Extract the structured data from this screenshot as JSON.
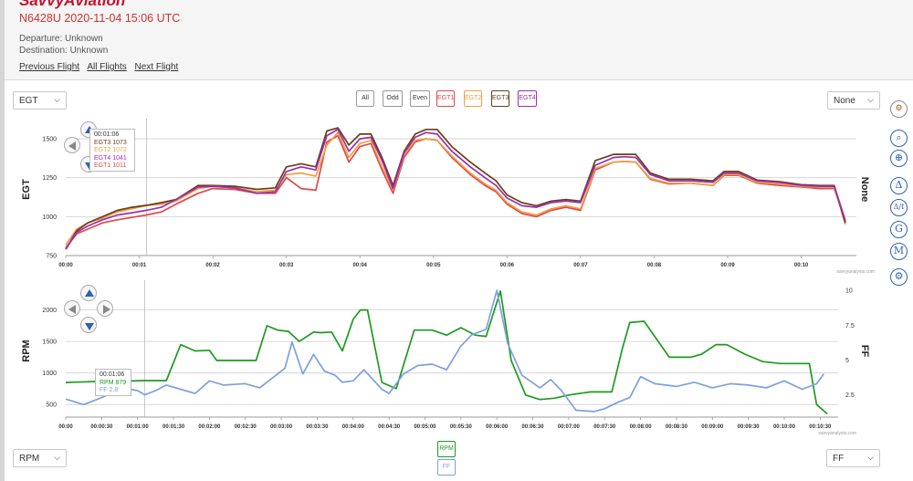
{
  "header": {
    "logo": "SavvyAviation",
    "flight_title": "N6428U 2020-11-04 15:06 UTC",
    "departure": "Departure: Unknown",
    "destination": "Destination: Unknown",
    "prev_flight": "Previous Flight",
    "all_flights": "All Flights",
    "next_flight": "Next Flight"
  },
  "controls": {
    "top_left_select": "EGT",
    "top_right_select": "None",
    "bottom_left_select": "RPM",
    "bottom_right_select": "FF",
    "filters": [
      "All",
      "Odd",
      "Even",
      "EGT1",
      "EGT2",
      "EGT3",
      "EGT4"
    ],
    "bottom_buttons": [
      "RPM",
      "FF"
    ]
  },
  "right_toolbar": {
    "icons": [
      "gear-settings-icon",
      "zoom-reset-icon",
      "zoom-in-icon",
      "delta-icon",
      "delta-t-icon",
      "g-icon",
      "m-icon",
      "settings-icon"
    ],
    "glyphs": [
      "",
      "",
      "",
      "Δ",
      "Δ/t",
      "G",
      "M",
      ""
    ]
  },
  "colors": {
    "egt1": "#e04848",
    "egt2": "#f0a040",
    "egt3": "#6b3f1c",
    "egt4": "#9a2fb0",
    "rpm": "#1e9a1e",
    "ff": "#7ea0e0",
    "accent_blue": "#2f62b0",
    "title_red": "#d03030"
  },
  "tooltip_top": {
    "time": "00:01:06",
    "rows": [
      {
        "label": "EGT3",
        "value": "1073",
        "key": "egt3"
      },
      {
        "label": "EGT2",
        "value": "1072",
        "key": "egt2"
      },
      {
        "label": "EGT4",
        "value": "1041",
        "key": "egt4"
      },
      {
        "label": "EGT1",
        "value": "1011",
        "key": "egt1"
      }
    ]
  },
  "tooltip_bottom": {
    "time": "00:01:06",
    "rows": [
      {
        "label": "RPM",
        "value": "879",
        "key": "rpm"
      },
      {
        "label": "FF",
        "value": "2.8",
        "key": "ff"
      }
    ]
  },
  "watermark": "savvyanalysis.com",
  "chart_data": [
    {
      "type": "line",
      "ylabel": "EGT",
      "right_label": "None",
      "ylim": [
        750,
        1600
      ],
      "yticks": [
        750,
        1000,
        1250,
        1500
      ],
      "xlim": [
        0,
        10.75
      ],
      "xticks": [
        0,
        1,
        2,
        3,
        4,
        5,
        6,
        7,
        8,
        9,
        10
      ],
      "xtick_labels": [
        "00:00",
        "00:01",
        "00:02",
        "00:03",
        "00:04",
        "00:05",
        "00:06",
        "00:07",
        "00:08",
        "00:09",
        "00:10"
      ],
      "grid": true,
      "x": [
        0,
        0.15,
        0.3,
        0.5,
        0.7,
        0.9,
        1.1,
        1.3,
        1.5,
        1.8,
        2.0,
        2.3,
        2.6,
        2.85,
        3.0,
        3.2,
        3.4,
        3.55,
        3.7,
        3.85,
        4.0,
        4.15,
        4.3,
        4.45,
        4.6,
        4.75,
        4.9,
        5.05,
        5.25,
        5.5,
        5.7,
        5.85,
        6.0,
        6.2,
        6.4,
        6.6,
        6.8,
        7.0,
        7.2,
        7.45,
        7.6,
        7.75,
        7.95,
        8.2,
        8.5,
        8.8,
        8.95,
        9.15,
        9.4,
        9.7,
        10.0,
        10.25,
        10.45,
        10.6
      ],
      "series": [
        {
          "name": "EGT1",
          "key": "egt1",
          "values": [
            800,
            890,
            920,
            960,
            980,
            995,
            1011,
            1030,
            1080,
            1150,
            1180,
            1175,
            1150,
            1150,
            1250,
            1180,
            1170,
            1480,
            1520,
            1350,
            1450,
            1470,
            1300,
            1150,
            1380,
            1480,
            1500,
            1490,
            1380,
            1270,
            1200,
            1160,
            1080,
            1020,
            1000,
            1040,
            1060,
            1040,
            1300,
            1350,
            1355,
            1350,
            1240,
            1210,
            1215,
            1200,
            1265,
            1265,
            1215,
            1200,
            1190,
            1180,
            1180,
            970
          ]
        },
        {
          "name": "EGT2",
          "key": "egt2",
          "values": [
            820,
            920,
            960,
            990,
            1030,
            1050,
            1072,
            1080,
            1100,
            1180,
            1195,
            1185,
            1160,
            1170,
            1270,
            1280,
            1260,
            1460,
            1540,
            1380,
            1470,
            1490,
            1320,
            1170,
            1400,
            1490,
            1500,
            1490,
            1390,
            1280,
            1210,
            1170,
            1090,
            1030,
            1010,
            1050,
            1070,
            1050,
            1310,
            1350,
            1355,
            1350,
            1245,
            1215,
            1215,
            1200,
            1270,
            1270,
            1220,
            1210,
            1195,
            1190,
            1190,
            950
          ]
        },
        {
          "name": "EGT3",
          "key": "egt3",
          "values": [
            790,
            910,
            960,
            1000,
            1040,
            1060,
            1073,
            1090,
            1110,
            1200,
            1200,
            1195,
            1175,
            1185,
            1320,
            1340,
            1320,
            1550,
            1570,
            1460,
            1530,
            1530,
            1380,
            1200,
            1420,
            1530,
            1560,
            1560,
            1450,
            1350,
            1280,
            1230,
            1140,
            1090,
            1070,
            1100,
            1110,
            1100,
            1360,
            1400,
            1400,
            1400,
            1280,
            1240,
            1240,
            1230,
            1290,
            1290,
            1235,
            1225,
            1205,
            1200,
            1200,
            960
          ]
        },
        {
          "name": "EGT4",
          "key": "egt4",
          "values": [
            790,
            900,
            940,
            980,
            1010,
            1025,
            1041,
            1060,
            1110,
            1190,
            1195,
            1185,
            1150,
            1160,
            1290,
            1320,
            1300,
            1520,
            1560,
            1420,
            1500,
            1510,
            1360,
            1180,
            1410,
            1510,
            1540,
            1530,
            1420,
            1320,
            1250,
            1200,
            1120,
            1070,
            1060,
            1090,
            1100,
            1090,
            1330,
            1380,
            1385,
            1380,
            1270,
            1230,
            1230,
            1220,
            1280,
            1280,
            1230,
            1220,
            1200,
            1195,
            1195,
            975
          ]
        }
      ]
    },
    {
      "type": "line",
      "ylabel": "RPM",
      "right_label": "FF",
      "ylim": [
        300,
        2400
      ],
      "yticks": [
        500,
        1000,
        1500,
        2000
      ],
      "y2lim": [
        0.9,
        10.4
      ],
      "y2ticks": [
        2.5,
        5,
        7.5,
        10
      ],
      "xlim": [
        0,
        10.75
      ],
      "xticks": [
        0,
        0.5,
        1,
        1.5,
        2,
        2.5,
        3,
        3.5,
        4,
        4.5,
        5,
        5.5,
        6,
        6.5,
        7,
        7.5,
        8,
        8.5,
        9,
        9.5,
        10,
        10.5
      ],
      "xtick_labels": [
        "00:00",
        "00:00:30",
        "00:01:00",
        "00:01:30",
        "00:02:00",
        "00:02:30",
        "00:03:00",
        "00:03:30",
        "00:04:00",
        "00:04:30",
        "00:05:00",
        "00:05:30",
        "00:06:00",
        "00:06:30",
        "00:07:00",
        "00:07:30",
        "00:08:00",
        "00:08:30",
        "00:09:00",
        "00:09:30",
        "00:10:00",
        "00:10:30"
      ],
      "grid": true,
      "series": [
        {
          "name": "RPM",
          "key": "rpm",
          "axis": "left",
          "x": [
            0,
            0.3,
            0.5,
            0.8,
            1.1,
            1.4,
            1.6,
            1.8,
            2.0,
            2.1,
            2.5,
            2.65,
            2.8,
            2.95,
            3.1,
            3.25,
            3.45,
            3.55,
            3.7,
            3.85,
            4.0,
            4.1,
            4.2,
            4.4,
            4.6,
            4.85,
            5.1,
            5.3,
            5.5,
            5.7,
            5.85,
            6.05,
            6.2,
            6.4,
            6.6,
            6.8,
            7.0,
            7.3,
            7.4,
            7.6,
            7.75,
            7.85,
            8.05,
            8.4,
            8.7,
            8.85,
            9.05,
            9.2,
            9.45,
            9.7,
            9.95,
            10.35,
            10.45,
            10.6
          ],
          "values": [
            850,
            860,
            870,
            870,
            879,
            880,
            1450,
            1350,
            1360,
            1200,
            1200,
            1200,
            1750,
            1680,
            1660,
            1500,
            1650,
            1640,
            1650,
            1350,
            1850,
            2000,
            2000,
            850,
            750,
            1680,
            1680,
            1600,
            1720,
            1600,
            1580,
            2300,
            1200,
            650,
            580,
            600,
            650,
            700,
            700,
            700,
            1400,
            1800,
            1820,
            1250,
            1250,
            1300,
            1450,
            1450,
            1300,
            1180,
            1150,
            1150,
            500,
            350
          ]
        },
        {
          "name": "FF",
          "key": "ff",
          "axis": "right",
          "x": [
            0,
            0.25,
            0.5,
            0.8,
            1.0,
            1.1,
            1.25,
            1.4,
            1.6,
            1.8,
            2.0,
            2.2,
            2.5,
            2.7,
            2.9,
            3.05,
            3.15,
            3.3,
            3.45,
            3.6,
            3.75,
            3.85,
            4.0,
            4.15,
            4.4,
            4.5,
            4.7,
            4.9,
            5.1,
            5.3,
            5.5,
            5.65,
            5.85,
            6.0,
            6.15,
            6.35,
            6.6,
            6.75,
            6.9,
            7.1,
            7.35,
            7.5,
            7.7,
            7.85,
            8.0,
            8.2,
            8.5,
            8.75,
            9.0,
            9.25,
            9.5,
            9.75,
            10.0,
            10.25,
            10.45,
            10.55
          ],
          "values": [
            2.2,
            1.8,
            2.3,
            3.0,
            2.8,
            2.5,
            2.8,
            3.2,
            2.9,
            2.6,
            3.5,
            3.2,
            3.3,
            3.0,
            3.8,
            4.4,
            6.3,
            4.0,
            5.4,
            4.2,
            3.9,
            3.4,
            3.5,
            4.3,
            2.9,
            2.6,
            4.0,
            4.6,
            4.7,
            4.3,
            6.0,
            6.8,
            7.2,
            10.0,
            6.2,
            3.9,
            3.0,
            3.6,
            2.8,
            1.4,
            1.3,
            1.5,
            2.0,
            2.3,
            3.8,
            3.3,
            3.1,
            3.4,
            3.0,
            3.3,
            3.2,
            3.0,
            3.5,
            2.9,
            3.3,
            4.0
          ]
        }
      ]
    }
  ]
}
